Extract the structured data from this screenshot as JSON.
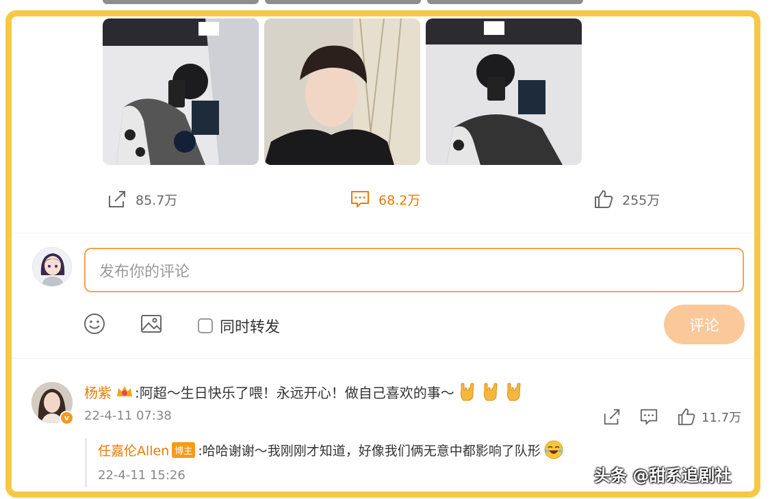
{
  "post": {
    "images": [
      {
        "name": "mirror-selfie-1"
      },
      {
        "name": "portrait"
      },
      {
        "name": "mirror-selfie-2"
      }
    ],
    "actions": {
      "repost": {
        "icon": "repost-icon",
        "count": "85.7万"
      },
      "comment": {
        "icon": "comment-icon",
        "count": "68.2万"
      },
      "like": {
        "icon": "like-icon",
        "count": "255万"
      }
    }
  },
  "composer": {
    "placeholder": "发布你的评论",
    "repost_label": "同时转发",
    "submit_label": "评论",
    "icons": [
      "emoji-icon",
      "image-icon"
    ]
  },
  "comments": [
    {
      "user": "杨紫",
      "text": ":阿超～生日快乐了喂！永远开心！做自己喜欢的事～",
      "time": "22-4-11 07:38",
      "likes": "11.7万",
      "reply": {
        "user": "任嘉伦Allen",
        "tag": "博主",
        "text": ":哈哈谢谢～我刚刚才知道，好像我们俩无意中都影响了队形",
        "time": "22-4-11 15:26"
      }
    }
  ],
  "watermark": "头条 @甜系追剧社",
  "colors": {
    "accent": "#eb7a00",
    "frame": "#f7c846",
    "button": "#fbc89a"
  }
}
